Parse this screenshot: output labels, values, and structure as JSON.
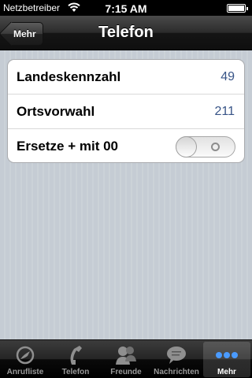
{
  "status_bar": {
    "carrier": "Netzbetreiber",
    "time": "7:15 AM"
  },
  "nav": {
    "back_label": "Mehr",
    "title": "Telefon"
  },
  "settings": {
    "rows": [
      {
        "label": "Landeskennzahl",
        "value": "49"
      },
      {
        "label": "Ortsvorwahl",
        "value": "211"
      },
      {
        "label": "Ersetze + mit 00",
        "toggle": "off"
      }
    ]
  },
  "tab_bar": {
    "tabs": [
      {
        "label": "Anrufliste",
        "icon": "call-history-icon"
      },
      {
        "label": "Telefon",
        "icon": "phone-handset-icon"
      },
      {
        "label": "Freunde",
        "icon": "contacts-icon"
      },
      {
        "label": "Nachrichten",
        "icon": "speech-bubble-icon"
      },
      {
        "label": "Mehr",
        "icon": "more-dots-icon",
        "active": true
      }
    ]
  },
  "colors": {
    "value_text": "#385487",
    "background": "#c5ccd4",
    "tab_active_icon": "#4a9bff"
  }
}
